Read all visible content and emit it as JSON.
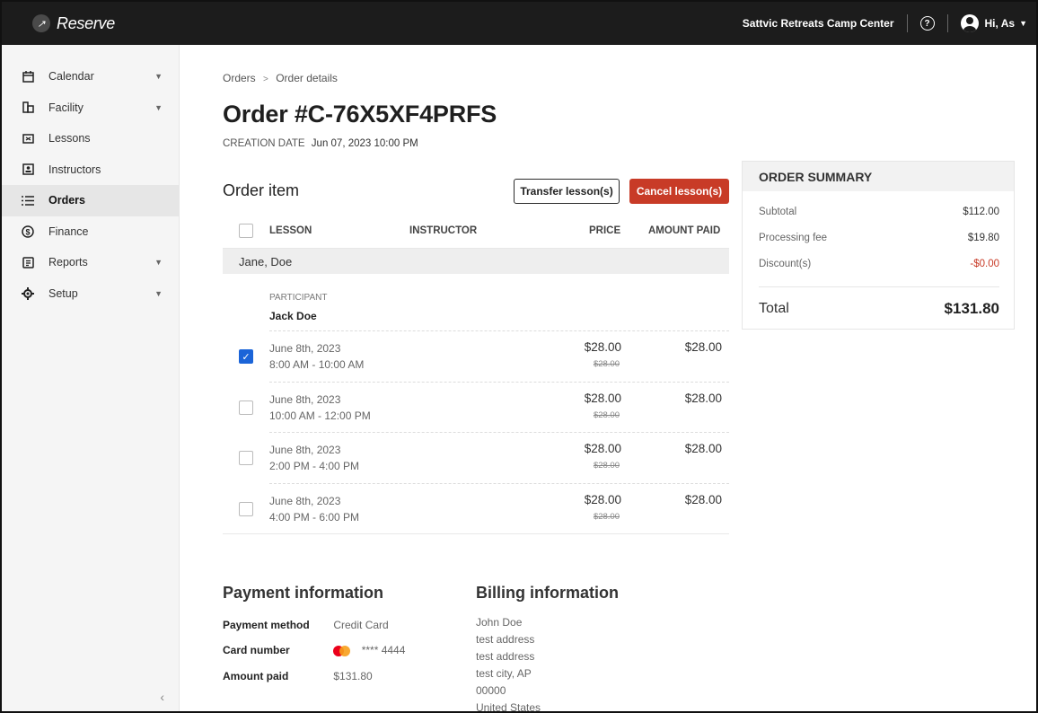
{
  "app": {
    "logo_text": "Reserve",
    "facility_name": "Sattvic Retreats Camp Center",
    "user_greeting": "Hi, As"
  },
  "sidebar": {
    "items": [
      {
        "label": "Calendar",
        "icon": "calendar-icon",
        "has_caret": true
      },
      {
        "label": "Facility",
        "icon": "facility-icon",
        "has_caret": true
      },
      {
        "label": "Lessons",
        "icon": "lessons-icon",
        "has_caret": false
      },
      {
        "label": "Instructors",
        "icon": "instructors-icon",
        "has_caret": false
      },
      {
        "label": "Orders",
        "icon": "orders-icon",
        "has_caret": false,
        "active": true
      },
      {
        "label": "Finance",
        "icon": "dollar-icon",
        "has_caret": false
      },
      {
        "label": "Reports",
        "icon": "reports-icon",
        "has_caret": true
      },
      {
        "label": "Setup",
        "icon": "gear-icon",
        "has_caret": true
      }
    ]
  },
  "breadcrumb": {
    "parent": "Orders",
    "separator": ">",
    "current": "Order details"
  },
  "order": {
    "title": "Order #C-76X5XF4PRFS",
    "creation_label": "CREATION DATE",
    "creation_value": "Jun 07, 2023 10:00 PM"
  },
  "order_item": {
    "title": "Order item",
    "transfer_label": "Transfer lesson(s)",
    "cancel_label": "Cancel lesson(s)",
    "columns": {
      "lesson": "LESSON",
      "instructor": "INSTRUCTOR",
      "price": "PRICE",
      "amount_paid": "AMOUNT PAID"
    },
    "group_name": "Jane, Doe",
    "participant_label": "PARTICIPANT",
    "participant_name": "Jack Doe",
    "rows": [
      {
        "date": "June 8th, 2023",
        "time": "8:00 AM - 10:00 AM",
        "price": "$28.00",
        "old_price": "$28.00",
        "paid": "$28.00",
        "checked": true
      },
      {
        "date": "June 8th, 2023",
        "time": "10:00 AM - 12:00 PM",
        "price": "$28.00",
        "old_price": "$28.00",
        "paid": "$28.00",
        "checked": false
      },
      {
        "date": "June 8th, 2023",
        "time": "2:00 PM - 4:00 PM",
        "price": "$28.00",
        "old_price": "$28.00",
        "paid": "$28.00",
        "checked": false
      },
      {
        "date": "June 8th, 2023",
        "time": "4:00 PM - 6:00 PM",
        "price": "$28.00",
        "old_price": "$28.00",
        "paid": "$28.00",
        "checked": false
      }
    ]
  },
  "summary": {
    "title": "ORDER SUMMARY",
    "subtotal_label": "Subtotal",
    "subtotal": "$112.00",
    "fee_label": "Processing fee",
    "fee": "$19.80",
    "discount_label": "Discount(s)",
    "discount": "-$0.00",
    "total_label": "Total",
    "total": "$131.80"
  },
  "payment": {
    "title": "Payment information",
    "method_label": "Payment method",
    "method": "Credit Card",
    "card_label": "Card number",
    "card": "**** 4444",
    "paid_label": "Amount paid",
    "paid": "$131.80"
  },
  "billing": {
    "title": "Billing information",
    "lines": [
      "John Doe",
      "test address",
      "test address",
      "test city, AP",
      "00000",
      "United States"
    ]
  },
  "colors": {
    "topbar": "#1c1c1c",
    "accent_red": "#c83b27",
    "checkbox_blue": "#1b64d8"
  }
}
